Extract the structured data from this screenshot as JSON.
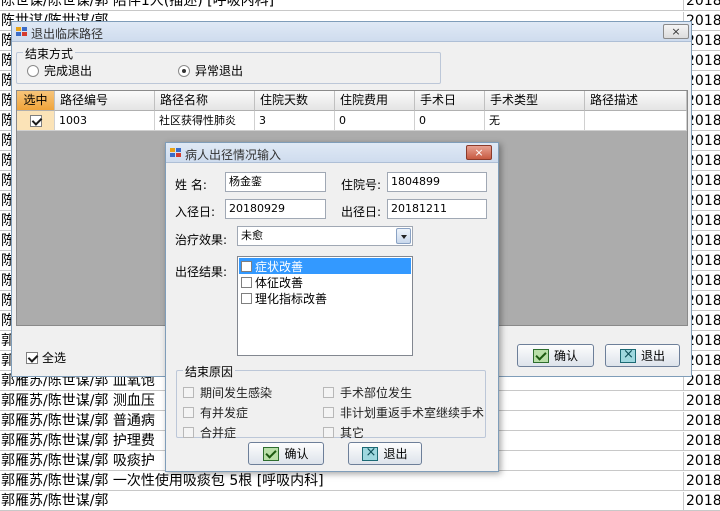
{
  "background": {
    "rows": [
      {
        "text": "陈世谋/陈世谋/郭 陪伴1人(描述)  [呼吸内科]",
        "right": "2018"
      },
      {
        "text": "陈世谋/陈世谋/郭",
        "right": "2018"
      },
      {
        "text": "陈世谋/陈世谋/郭",
        "right": "2018"
      },
      {
        "text": "陈世谋/陈世谋/郭",
        "right": "2018"
      },
      {
        "text": "陈世谋/陈世谋/郭",
        "right": "2018"
      },
      {
        "text": "陈世谋/陈世谋/郭",
        "right": "2018"
      },
      {
        "text": "陈世谋/陈世谋/郭",
        "right": "2018"
      },
      {
        "text": "陈世谋/陈世谋/郭",
        "right": "2018"
      },
      {
        "text": "陈世谋/陈世谋/郭",
        "right": "2018"
      },
      {
        "text": "陈世谋/陈世谋/郭",
        "right": "2018"
      },
      {
        "text": "陈世谋/陈世谋/郭",
        "right": "2018"
      },
      {
        "text": "陈世谋/陈世谋/郭",
        "right": "2018"
      },
      {
        "text": "陈世谋/陈世谋/郭",
        "right": "2018"
      },
      {
        "text": "陈世谋/陈世谋/郭",
        "right": "2018"
      },
      {
        "text": "陈世谋/陈世谋/郭",
        "right": "2018"
      },
      {
        "text": "陈世谋/陈世谋/郭",
        "right": "2018"
      },
      {
        "text": "陈世谋/陈世谋/郭",
        "right": "2018"
      },
      {
        "text": "郭雁苏/陈世谋/郭",
        "right": "2018"
      },
      {
        "text": "郭雁苏/陈世谋/郭",
        "right": "2018"
      },
      {
        "text": "郭雁苏/陈世谋/郭 血氧饱",
        "right": "2018"
      },
      {
        "text": "郭雁苏/陈世谋/郭 测血压",
        "right": "2018"
      },
      {
        "text": "郭雁苏/陈世谋/郭 普通病",
        "right": "2018"
      },
      {
        "text": "郭雁苏/陈世谋/郭 护理费",
        "right": "2018"
      },
      {
        "text": "郭雁苏/陈世谋/郭 吸痰护",
        "right": "2018"
      },
      {
        "text": "郭雁苏/陈世谋/郭 一次性使用吸痰包  5根  [呼吸内科]",
        "right": "2018"
      },
      {
        "text": "郭雁苏/陈世谋/郭",
        "right": "2018"
      }
    ]
  },
  "exit_window": {
    "title": "退出临床路径",
    "close_label": "×",
    "end_method": {
      "legend": "结束方式",
      "options": [
        {
          "label": "完成退出",
          "selected": false
        },
        {
          "label": "异常退出",
          "selected": true
        }
      ]
    },
    "grid": {
      "columns": [
        "选中",
        "路径编号",
        "路径名称",
        "住院天数",
        "住院费用",
        "手术日",
        "手术类型",
        "路径描述"
      ],
      "rows": [
        {
          "checked": true,
          "cells": [
            "1003",
            "社区获得性肺炎",
            "3",
            "0",
            "0",
            "无",
            ""
          ]
        }
      ]
    },
    "select_all_label": "全选",
    "select_all_checked": true,
    "confirm_label": "确认",
    "exit_label": "退出"
  },
  "patient_dialog": {
    "title": "病人出径情况输入",
    "close_label": "×",
    "name_label": "姓  名:",
    "name_value": "杨金銮",
    "admission_no_label": "住院号:",
    "admission_no_value": "1804899",
    "entry_date_label": "入径日:",
    "entry_date_value": "20180929",
    "exit_date_label": "出径日:",
    "exit_date_value": "20181211",
    "treatment_effect_label": "治疗效果:",
    "treatment_effect_value": "未愈",
    "exit_result_label": "出径结果:",
    "exit_result_items": [
      {
        "label": "症状改善",
        "checked": false,
        "selected": true
      },
      {
        "label": "体征改善",
        "checked": false,
        "selected": false
      },
      {
        "label": "理化指标改善",
        "checked": false,
        "selected": false
      }
    ],
    "end_reason": {
      "legend": "结束原因",
      "options": [
        {
          "label": "期间发生感染"
        },
        {
          "label": "手术部位发生"
        },
        {
          "label": "有并发症"
        },
        {
          "label": "非计划重返手术室继续手术"
        },
        {
          "label": "合并症"
        },
        {
          "label": "其它"
        }
      ]
    },
    "confirm_label": "确认",
    "exit_label": "退出"
  },
  "colors": {
    "selected_highlight": "#3399ff",
    "grid_header_accent": "#f0a43a"
  }
}
